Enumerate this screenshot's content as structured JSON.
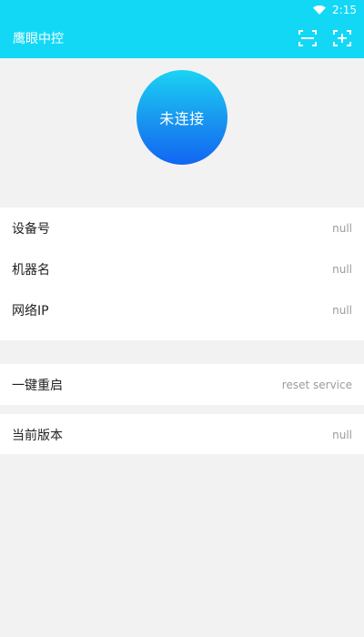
{
  "status_bar": {
    "time": "2:15"
  },
  "app_bar": {
    "title": "鹰眼中控",
    "actions": [
      "scan-icon",
      "add-box-icon"
    ]
  },
  "hero": {
    "connect_label": "未连接",
    "gradient": [
      "#1ad3f4",
      "#1893f0",
      "#1166f2"
    ]
  },
  "info_card": {
    "rows": [
      {
        "label": "设备号",
        "value": "null"
      },
      {
        "label": "机器名",
        "value": "null"
      },
      {
        "label": "网络IP",
        "value": "null"
      }
    ]
  },
  "reset_card": {
    "label": "一键重启",
    "value": "reset service"
  },
  "version_card": {
    "label": "当前版本",
    "value": "null"
  },
  "colors": {
    "accent": "#12d8f6",
    "background": "#f2f2f2",
    "card": "#ffffff",
    "muted_text": "#9b9b9b"
  }
}
